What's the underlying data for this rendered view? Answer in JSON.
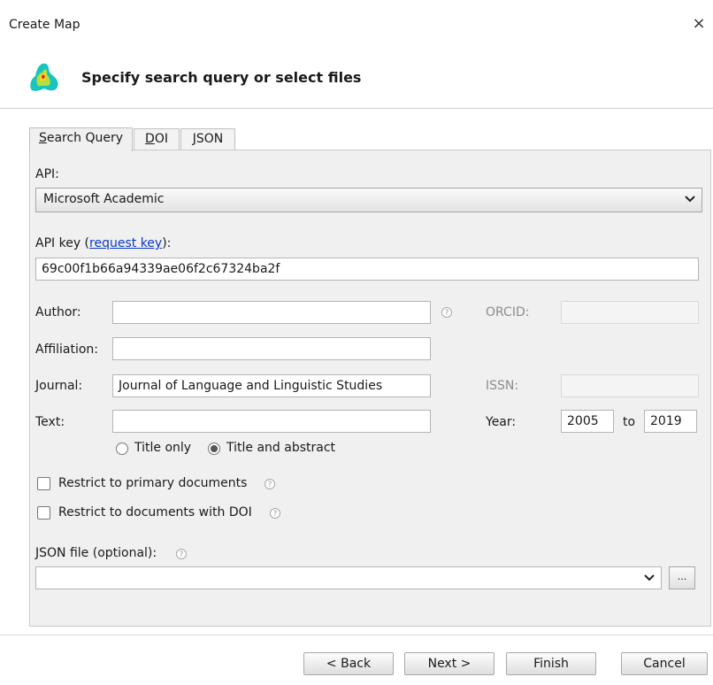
{
  "window": {
    "title": "Create Map",
    "close_glyph": "×"
  },
  "header": {
    "title": "Specify search query or select files",
    "logo_icon": "map-logo-icon"
  },
  "tabs": [
    {
      "label_hotkey": "S",
      "label_rest": "earch Query",
      "active": true
    },
    {
      "label_hotkey": "D",
      "label_rest": "OI",
      "active": false
    },
    {
      "label_hotkey": "J",
      "label_rest": "SON",
      "active": false
    }
  ],
  "form": {
    "api_label": "API:",
    "api_value": "Microsoft Academic",
    "api_key_label": "API key (",
    "api_key_link": "request key",
    "api_key_suffix": "):",
    "api_key_value": "69c00f1b66a94339ae06f2c67324ba2f",
    "author_label": "Author:",
    "author_value": "",
    "orcid_label": "ORCID:",
    "orcid_value": "",
    "affiliation_label": "Affiliation:",
    "affiliation_value": "",
    "journal_label": "Journal:",
    "journal_value": "Journal of Language and Linguistic Studies",
    "issn_label": "ISSN:",
    "issn_value": "",
    "text_label": "Text:",
    "text_value": "",
    "year_label": "Year:",
    "year_from": "2005",
    "year_to_label": "to",
    "year_to": "2019",
    "radio_title_only": "Title only",
    "radio_title_abstract": "Title and abstract",
    "radio_selected": "title_abstract",
    "checkbox_primary": "Restrict to primary documents",
    "checkbox_primary_checked": false,
    "checkbox_doi": "Restrict to documents with DOI",
    "checkbox_doi_checked": false,
    "json_file_label": "JSON file (optional):",
    "json_file_value": "",
    "browse_label": "...",
    "help_glyph": "?"
  },
  "footer": {
    "back": "< Back",
    "next": "Next >",
    "finish": "Finish",
    "cancel": "Cancel"
  },
  "colors": {
    "link": "#0b38c6",
    "panel": "#f0f0f0",
    "border": "#c9c9c9"
  }
}
